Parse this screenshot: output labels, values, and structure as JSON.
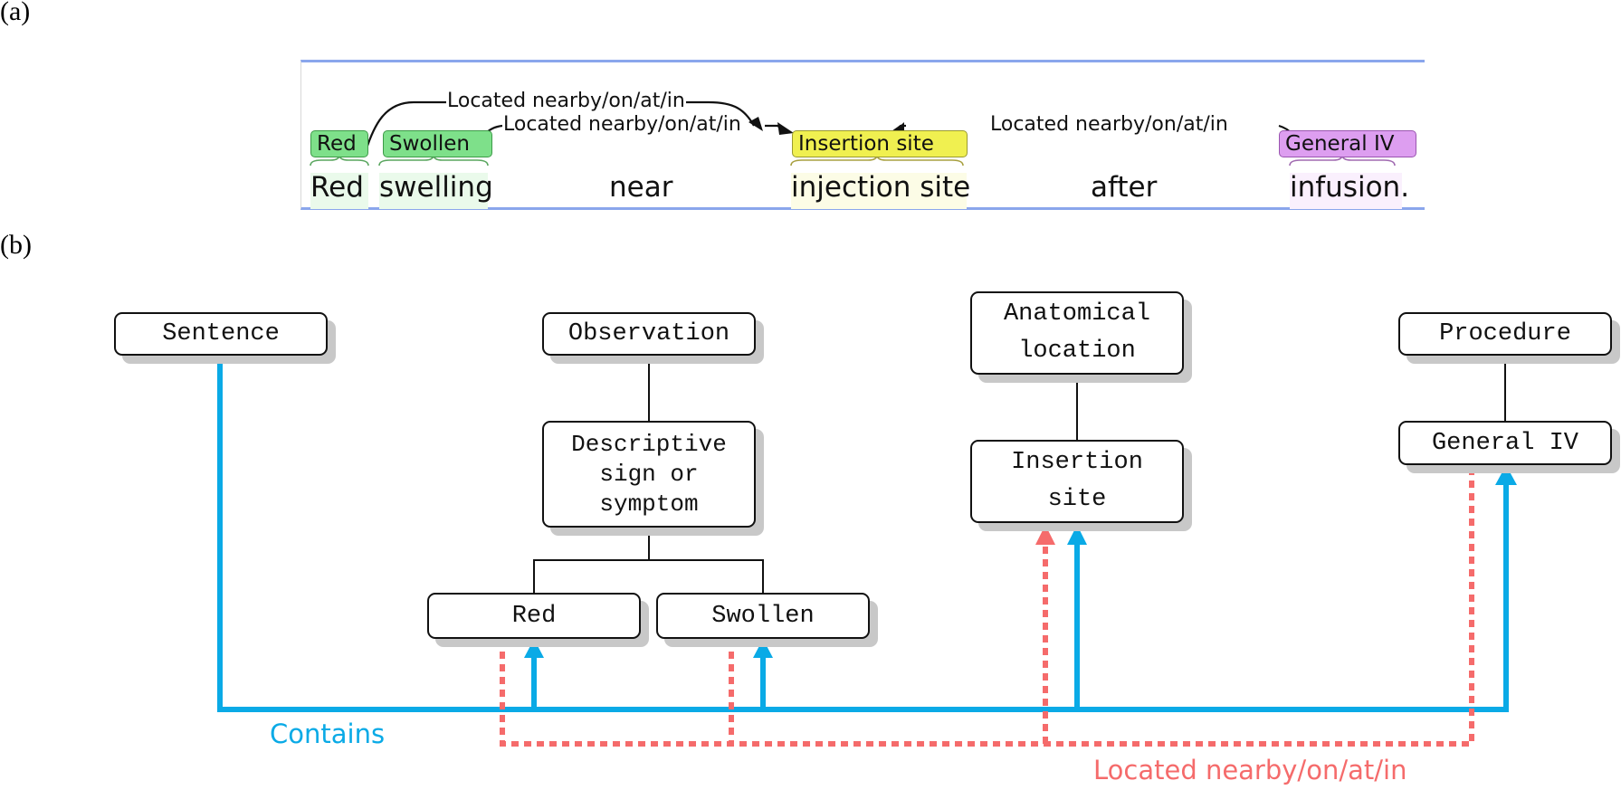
{
  "panel_labels": {
    "a": "(a)",
    "b": "(b)"
  },
  "colors": {
    "contains": "#0aaae6",
    "located": "#f56b6b",
    "observation_entity": "#7ee08a",
    "anatomical_entity": "#f0f050",
    "procedure_entity": "#dd9ef0",
    "strip_border": "#8aa6ec"
  },
  "panel_a": {
    "tokens": [
      "Red",
      "swelling",
      "near",
      "injection site",
      "after",
      "infusion."
    ],
    "entities": [
      {
        "label": "Red",
        "type": "observation"
      },
      {
        "label": "Swollen",
        "type": "observation"
      },
      {
        "label": "Insertion site",
        "type": "anatomical"
      },
      {
        "label": "General IV",
        "type": "procedure"
      }
    ],
    "relations": [
      {
        "label": "Located nearby/on/at/in",
        "from": "Red",
        "to": "Insertion site"
      },
      {
        "label": "Located nearby/on/at/in",
        "from": "Swollen",
        "to": "Insertion site"
      },
      {
        "label": "Located nearby/on/at/in",
        "from": "General IV",
        "to": "Insertion site"
      }
    ]
  },
  "panel_b": {
    "nodes": {
      "sentence": "Sentence",
      "observation": "Observation",
      "descriptive": "Descriptive\nsign or\nsymptom",
      "red": "Red",
      "swollen": "Swollen",
      "anatomical": "Anatomical\nlocation",
      "insertion": "Insertion\nsite",
      "procedure": "Procedure",
      "general_iv": "General IV"
    },
    "legend": {
      "contains": "Contains",
      "located": "Located nearby/on/at/in"
    }
  }
}
